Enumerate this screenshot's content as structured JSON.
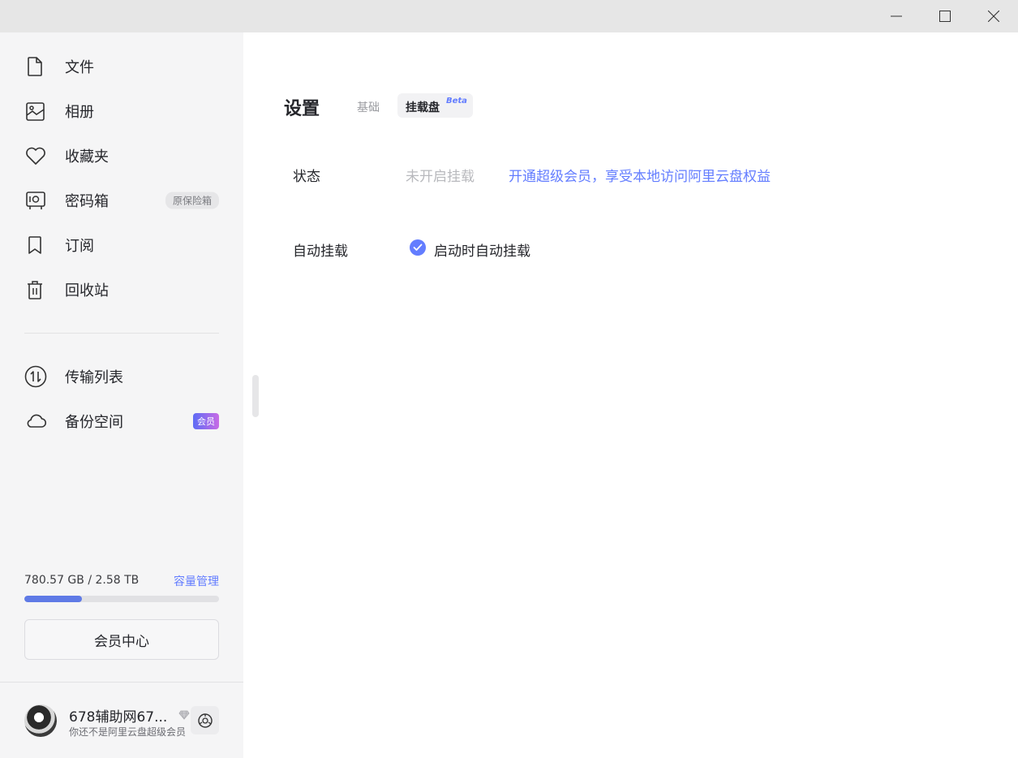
{
  "window": {
    "minimize_icon": "minimize-icon",
    "maximize_icon": "maximize-icon",
    "close_icon": "close-icon"
  },
  "sidebar": {
    "items": [
      {
        "label": "文件",
        "icon": "file-icon"
      },
      {
        "label": "相册",
        "icon": "photo-icon"
      },
      {
        "label": "收藏夹",
        "icon": "heart-icon"
      },
      {
        "label": "密码箱",
        "icon": "safe-icon",
        "badge": "原保险箱"
      },
      {
        "label": "订阅",
        "icon": "bookmark-icon"
      },
      {
        "label": "回收站",
        "icon": "trash-icon"
      },
      {
        "label": "传输列表",
        "icon": "transfer-icon"
      },
      {
        "label": "备份空间",
        "icon": "cloud-icon",
        "badge": "会员"
      }
    ],
    "storage": {
      "text": "780.57 GB / 2.58 TB",
      "manage_link": "容量管理",
      "used_fraction": 0.295
    },
    "member_button": "会员中心",
    "user": {
      "name": "678辅助网67...",
      "subtitle": "你还不是阿里云盘超级会员"
    }
  },
  "settings": {
    "title": "设置",
    "tabs": [
      {
        "label": "基础"
      },
      {
        "label": "挂载盘",
        "tag": "Beta",
        "active": true
      }
    ],
    "status": {
      "label": "状态",
      "value": "未开启挂载",
      "link": "开通超级会员，享受本地访问阿里云盘权益"
    },
    "auto_mount": {
      "label": "自动挂载",
      "option": "启动时自动挂载",
      "checked": true
    }
  },
  "colors": {
    "accent": "#637dff",
    "sidebar_bg": "#f5f5f6",
    "titlebar_bg": "#e6e6e6"
  }
}
